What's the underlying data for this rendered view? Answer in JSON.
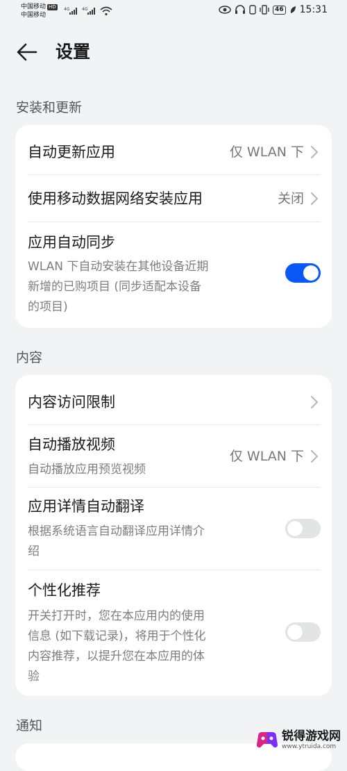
{
  "status": {
    "carrier1": "中国移动",
    "carrier1_badge": "HD",
    "carrier2": "中国移动",
    "net1": "4G",
    "net2": "4G",
    "battery": "46",
    "time": "15:31"
  },
  "header": {
    "title": "设置"
  },
  "sections": {
    "install": {
      "label": "安装和更新",
      "auto_update": {
        "title": "自动更新应用",
        "value": "仅 WLAN 下"
      },
      "mobile_install": {
        "title": "使用移动数据网络安装应用",
        "value": "关闭"
      },
      "auto_sync": {
        "title": "应用自动同步",
        "sub1": "WLAN 下自动安装在其他设备近期",
        "sub2": "新增的已购项目 (同步适配本设备",
        "sub3": "的项目)",
        "enabled": true
      }
    },
    "content": {
      "label": "内容",
      "access_limit": {
        "title": "内容访问限制"
      },
      "autoplay": {
        "title": "自动播放视频",
        "sub": "自动播放应用预览视频",
        "value": "仅 WLAN 下"
      },
      "translate": {
        "title": "应用详情自动翻译",
        "sub1": "根据系统语言自动翻译应用详情介",
        "sub2": "绍",
        "enabled": false
      },
      "personalize": {
        "title": "个性化推荐",
        "sub1": "开关打开时，您在本应用内的使用",
        "sub2": "信息 (如下载记录)，将用于个性化",
        "sub3": "内容推荐，以提升您在本应用的体",
        "sub4": "验",
        "enabled": false
      }
    },
    "notify": {
      "label": "通知"
    }
  },
  "watermark": {
    "name": "锐得游戏网",
    "url": "www.ytruida.com"
  },
  "colors": {
    "accent": "#0a59f7",
    "background": "#f1f3f5",
    "card": "#ffffff"
  }
}
